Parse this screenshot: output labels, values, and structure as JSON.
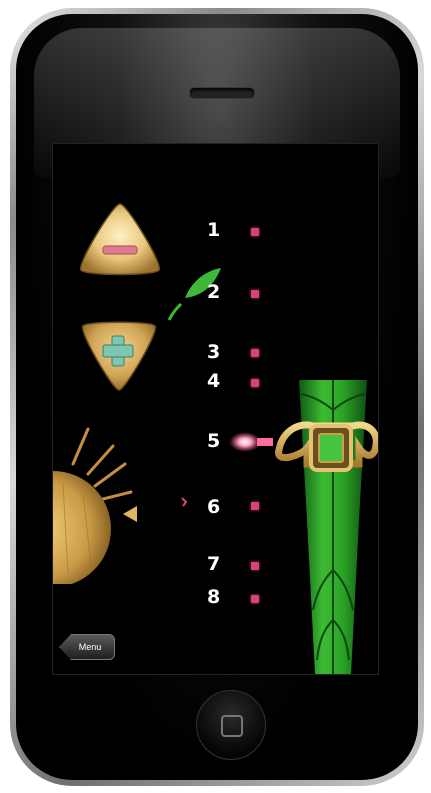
{
  "levels": [
    {
      "label": "1"
    },
    {
      "label": "2"
    },
    {
      "label": "3"
    },
    {
      "label": "4"
    },
    {
      "label": "5"
    },
    {
      "label": "6"
    },
    {
      "label": "7"
    },
    {
      "label": "8"
    }
  ],
  "menu_button": {
    "label": "Menu"
  },
  "icons": {
    "minus": "minus-icon",
    "plus": "plus-icon"
  },
  "colors": {
    "background": "#000000",
    "marker": "#d94277",
    "vine_green": "#2ea82a",
    "gold": "#d8b25a"
  }
}
